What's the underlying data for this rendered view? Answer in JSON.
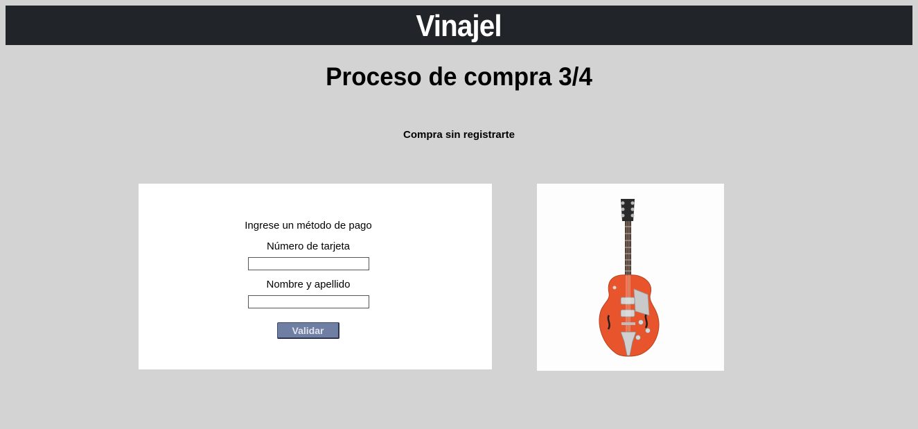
{
  "header": {
    "brand": "Vinajel"
  },
  "page": {
    "title": "Proceso de compra 3/4",
    "subtitle": "Compra sin registrarte"
  },
  "form": {
    "heading": "Ingrese un método de pago",
    "card_number_label": "Número de tarjeta",
    "card_number_value": "",
    "name_label": "Nombre y apellido",
    "name_value": "",
    "submit_label": "Validar"
  },
  "product_image": {
    "icon": "electric-guitar",
    "body_color": "#e8542b"
  }
}
